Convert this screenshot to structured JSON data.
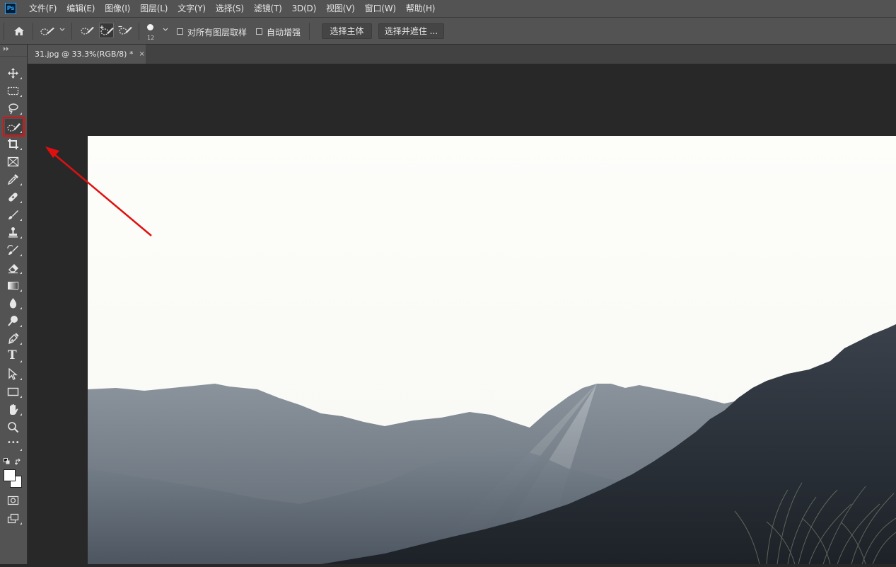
{
  "app": {
    "logo_text": "Ps",
    "accent_color": "#31a8ff"
  },
  "menu": {
    "items": [
      {
        "label": "文件(F)"
      },
      {
        "label": "编辑(E)"
      },
      {
        "label": "图像(I)"
      },
      {
        "label": "图层(L)"
      },
      {
        "label": "文字(Y)"
      },
      {
        "label": "选择(S)"
      },
      {
        "label": "滤镜(T)"
      },
      {
        "label": "3D(D)"
      },
      {
        "label": "视图(V)"
      },
      {
        "label": "窗口(W)"
      },
      {
        "label": "帮助(H)"
      }
    ]
  },
  "options_bar": {
    "home_icon": "home-icon",
    "tool_preset_icon": "quick-selection-icon",
    "brush_modes": [
      {
        "icon": "new-selection-brush-icon",
        "active": false
      },
      {
        "icon": "add-to-selection-brush-icon",
        "active": true
      },
      {
        "icon": "subtract-from-selection-brush-icon",
        "active": false
      }
    ],
    "brush_size": "12",
    "sample_all_layers_label": "对所有图层取样",
    "auto_enhance_label": "自动增强",
    "select_subject_label": "选择主体",
    "select_and_mask_label": "选择并遮住 ..."
  },
  "toolbar": {
    "tools": [
      {
        "name": "move-tool",
        "icon": "move-icon"
      },
      {
        "name": "marquee-tool",
        "icon": "rectangle-marquee-icon"
      },
      {
        "name": "lasso-tool",
        "icon": "lasso-icon"
      },
      {
        "name": "quick-selection-tool",
        "icon": "quick-selection-icon",
        "highlighted": true
      },
      {
        "name": "crop-tool",
        "icon": "crop-icon"
      },
      {
        "name": "frame-tool",
        "icon": "frame-icon"
      },
      {
        "name": "eyedropper-tool",
        "icon": "eyedropper-icon"
      },
      {
        "name": "healing-brush-tool",
        "icon": "bandage-icon"
      },
      {
        "name": "brush-tool",
        "icon": "brush-icon"
      },
      {
        "name": "clone-stamp-tool",
        "icon": "stamp-icon"
      },
      {
        "name": "history-brush-tool",
        "icon": "history-brush-icon"
      },
      {
        "name": "eraser-tool",
        "icon": "eraser-icon"
      },
      {
        "name": "gradient-tool",
        "icon": "gradient-icon"
      },
      {
        "name": "blur-tool",
        "icon": "drop-icon"
      },
      {
        "name": "dodge-tool",
        "icon": "dodge-icon"
      },
      {
        "name": "pen-tool",
        "icon": "pen-icon"
      },
      {
        "name": "type-tool",
        "icon": "type-icon",
        "glyph": "T"
      },
      {
        "name": "path-selection-tool",
        "icon": "arrow-cursor-icon"
      },
      {
        "name": "rectangle-tool",
        "icon": "rectangle-icon"
      },
      {
        "name": "hand-tool",
        "icon": "hand-icon"
      },
      {
        "name": "zoom-tool",
        "icon": "zoom-icon"
      },
      {
        "name": "edit-toolbar",
        "icon": "more-icon",
        "glyph": "•••"
      }
    ],
    "color_swatches": {
      "foreground": "#ffffff",
      "background": "#ffffff"
    },
    "quick_mask_icon": "quick-mask-icon",
    "screen_mode_icon": "screen-mode-icon"
  },
  "document": {
    "tab_title": "31.jpg @ 33.3%(RGB/8) *",
    "close_glyph": "×"
  },
  "annotation": {
    "color": "#e01010"
  }
}
